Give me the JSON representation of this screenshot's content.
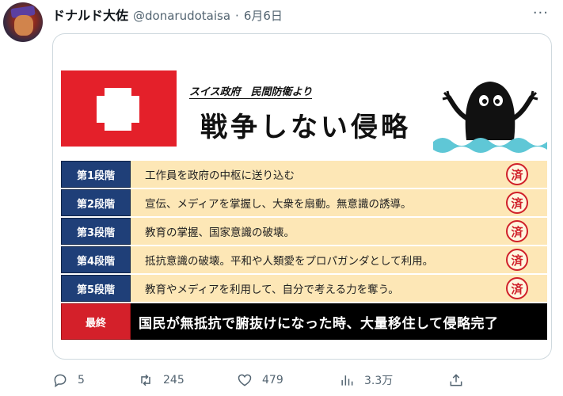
{
  "tweet": {
    "display_name": "ドナルド大佐",
    "handle": "@donarudotaisa",
    "separator": "·",
    "date": "6月6日",
    "more": "···"
  },
  "image": {
    "source_label": "スイス政府　民間防衛より",
    "title": "戦争しない侵略",
    "stamp_text": "済",
    "stages": [
      {
        "label": "第1段階",
        "text": "工作員を政府の中枢に送り込む"
      },
      {
        "label": "第2段階",
        "text": "宣伝、メディアを掌握し、大衆を扇動。無意識の誘導。"
      },
      {
        "label": "第3段階",
        "text": "教育の掌握、国家意識の破壊。"
      },
      {
        "label": "第4段階",
        "text": "抵抗意識の破壊。平和や人類愛をプロパガンダとして利用。"
      },
      {
        "label": "第5段階",
        "text": "教育やメディアを利用して、自分で考える力を奪う。"
      }
    ],
    "final": {
      "label": "最終",
      "text": "国民が無抵抗で腑抜けになった時、大量移住して侵略完了"
    },
    "colors": {
      "flag_red": "#e4202a",
      "stage_navy": "#1f3f78",
      "stage_bg": "#fde7b6",
      "stamp_red": "#d0202a"
    }
  },
  "actions": {
    "replies": "5",
    "retweets": "245",
    "likes": "479",
    "views": "3.3万"
  }
}
